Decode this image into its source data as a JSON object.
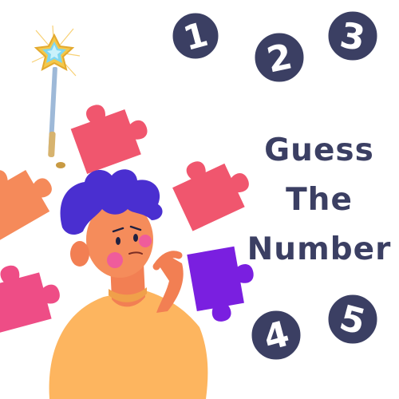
{
  "title": {
    "line1": "Guess",
    "line2": "The",
    "line3": "Number"
  },
  "badges": [
    "1",
    "2",
    "3",
    "4",
    "5"
  ],
  "colors": {
    "badge_fill": "#3b3f63",
    "badge_text": "#ffffff",
    "title": "#3b3f63",
    "puzzle_coral": "#f0566e",
    "puzzle_orange": "#f58a5a",
    "puzzle_pink": "#ee4d86",
    "puzzle_purple": "#7a1fe0",
    "hair": "#4a2fd0",
    "skin": "#f58c5b",
    "shirt": "#fdb55f"
  },
  "icons": [
    "magic-wand-icon",
    "puzzle-piece-icon",
    "thinking-boy-illustration"
  ]
}
